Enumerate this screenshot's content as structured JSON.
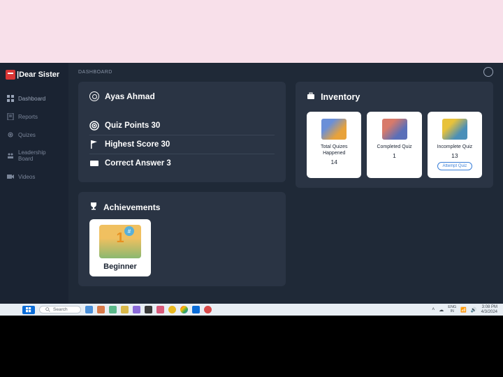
{
  "brand": {
    "name": "|Dear Sister"
  },
  "sidebar": {
    "items": [
      {
        "label": "Dashboard",
        "icon": "grid"
      },
      {
        "label": "Reports",
        "icon": "file"
      },
      {
        "label": "Quizes",
        "icon": "gear"
      },
      {
        "label": "Leadership Board",
        "icon": "users"
      },
      {
        "label": "Videos",
        "icon": "video"
      }
    ]
  },
  "breadcrumb": "DASHBOARD",
  "user": {
    "name": "Ayas Ahmad",
    "stats": [
      {
        "label": "Quiz Points",
        "value": "30"
      },
      {
        "label": "Highest Score",
        "value": "30"
      },
      {
        "label": "Correct Answer",
        "value": "3"
      }
    ]
  },
  "inventory": {
    "title": "Inventory",
    "items": [
      {
        "label": "Total Quizes Happened",
        "value": "14"
      },
      {
        "label": "Completed Quiz",
        "value": "1"
      },
      {
        "label": "Incomplete Quiz",
        "value": "13",
        "button": "Attempt Quiz"
      }
    ]
  },
  "achievements": {
    "title": "Achievements",
    "items": [
      {
        "label": "Beginner"
      }
    ]
  },
  "taskbar": {
    "search_placeholder": "Search",
    "lang": "ENG",
    "region": "IN",
    "time": "3:08 PM",
    "date": "4/3/2024"
  }
}
